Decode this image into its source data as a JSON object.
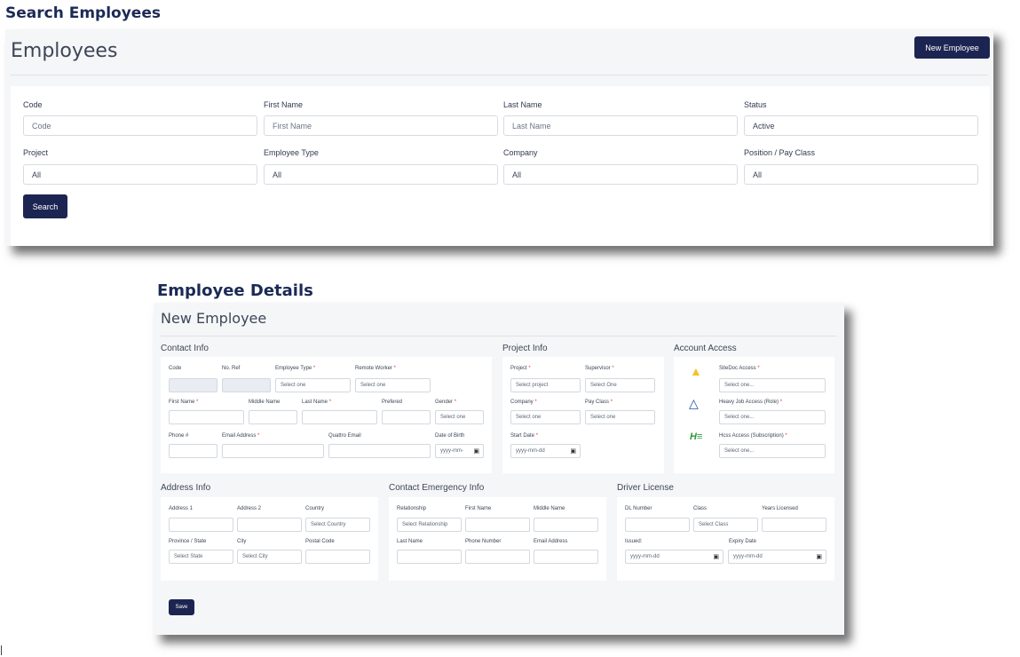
{
  "headings": {
    "search": "Search Employees",
    "details": "Employee Details"
  },
  "search_panel": {
    "title": "Employees",
    "new_button": "New Employee",
    "fields": [
      {
        "label": "Code",
        "placeholder": "Code"
      },
      {
        "label": "First Name",
        "placeholder": "First Name"
      },
      {
        "label": "Last Name",
        "placeholder": "Last Name"
      },
      {
        "label": "Status",
        "value": "Active"
      },
      {
        "label": "Project",
        "value": "All"
      },
      {
        "label": "Employee Type",
        "value": "All"
      },
      {
        "label": "Company",
        "value": "All"
      },
      {
        "label": "Position / Pay Class",
        "value": "All"
      }
    ],
    "search_button": "Search"
  },
  "details_panel": {
    "title": "New Employee",
    "sections": {
      "contact": "Contact Info",
      "project": "Project Info",
      "access": "Account Access",
      "address": "Address Info",
      "emergency": "Contact Emergency Info",
      "license": "Driver License"
    },
    "contact": {
      "code": "Code",
      "no_ref": "No. Ref",
      "employee_type": "Employee Type",
      "remote_worker": "Remote Worker",
      "first_name": "First Name",
      "middle_name": "Middle Name",
      "last_name": "Last Name",
      "prefered": "Prefered",
      "gender": "Gender",
      "phone": "Phone #",
      "email": "Email Address",
      "quattro_email": "Quattro Email",
      "dob": "Date of Birth",
      "select_one": "Select one",
      "date_placeholder": "yyyy-mm-"
    },
    "project": {
      "project": "Project",
      "supervisor": "Supervisor",
      "company": "Company",
      "pay_class": "Pay Class",
      "start_date": "Start Date",
      "select_project": "Select project",
      "select_one_cap": "Select One",
      "select_one": "Select one",
      "date_placeholder": "yyyy-mm-dd"
    },
    "access": {
      "sitedoc": "SiteDoc Access",
      "heavyjob": "Heavy Job Access (Role)",
      "hcss": "Hcss Access (Subscription)",
      "select_one": "Select one..."
    },
    "address": {
      "address1": "Address 1",
      "address2": "Address 2",
      "country": "Country",
      "province": "Province / State",
      "city": "City",
      "postal": "Postal Code",
      "select_country": "Select Country",
      "select_state": "Select State",
      "select_city": "Select City"
    },
    "emergency": {
      "relationship": "Relationship",
      "first_name": "First Name",
      "middle_name": "Middle Name",
      "last_name": "Last Name",
      "phone": "Phone Number",
      "email": "Email Address",
      "select_relationship": "Select Relationship"
    },
    "license": {
      "dl_number": "DL Number",
      "class": "Class",
      "years": "Years Licensed",
      "issued": "Issued:",
      "expiry": "Expiry Date",
      "select_class": "Select Class",
      "date_placeholder": "yyyy-mm-dd"
    },
    "required_mark": "*",
    "save_button": "Save"
  },
  "colors": {
    "accent": "#1c2552",
    "required": "#e23b3b",
    "heading": "#1b2a55"
  },
  "icons": [
    "sitedoc-triangle-icon",
    "heavyjob-triangle-icon",
    "hcss-logo-icon",
    "calendar-icon"
  ]
}
